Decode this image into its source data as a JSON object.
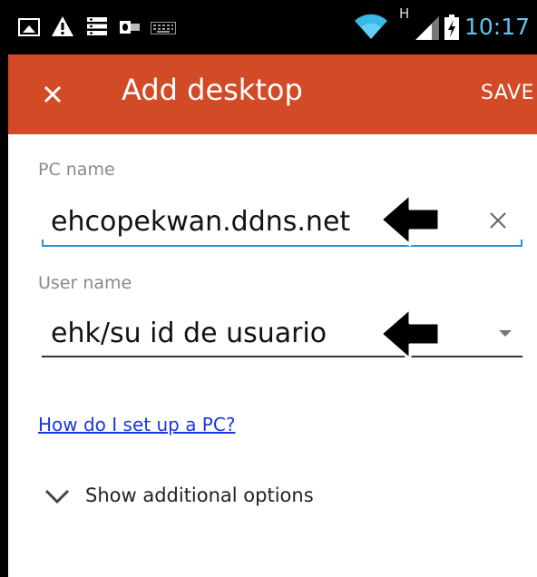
{
  "status_bar": {
    "time": "10:17",
    "network_type": "H",
    "icons": [
      "gallery-icon",
      "warning-icon",
      "list-icon",
      "outlook-icon",
      "keyboard-icon",
      "wifi-icon",
      "signal-icon",
      "battery-icon"
    ]
  },
  "app_bar": {
    "title": "Add desktop",
    "save_label": "SAVE",
    "close_icon": "close-icon",
    "color": "#d24a26"
  },
  "form": {
    "pc_name": {
      "label": "PC name",
      "value": "ehcopekwan.ddns.net",
      "clear_icon": "clear-icon"
    },
    "user_name": {
      "label": "User name",
      "value": "ehk/su id de usuario",
      "dropdown_icon": "dropdown-caret-icon"
    }
  },
  "help_link": "How do I set up a PC?",
  "additional_options": {
    "label": "Show additional options",
    "icon": "chevron-down-icon"
  },
  "colors": {
    "accent": "#2a8fd0",
    "link": "#1a36e0",
    "time": "#5fc8f0"
  }
}
